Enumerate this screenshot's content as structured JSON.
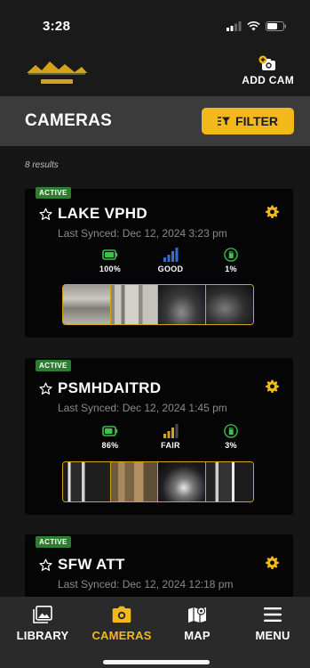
{
  "status_bar": {
    "time": "3:28"
  },
  "header": {
    "add_cam_label": "ADD CAM"
  },
  "title_bar": {
    "title": "CAMERAS",
    "filter_label": "FILTER"
  },
  "results": {
    "count_text": "8 results"
  },
  "cameras": [
    {
      "status": "ACTIVE",
      "name": "LAKE VPHD",
      "last_synced": "Last Synced: Dec 12, 2024 3:23 pm",
      "battery": "100%",
      "signal": "GOOD",
      "storage": "1%"
    },
    {
      "status": "ACTIVE",
      "name": "PSMHDAITRD",
      "last_synced": "Last Synced: Dec 12, 2024 1:45 pm",
      "battery": "86%",
      "signal": "FAIR",
      "storage": "3%"
    },
    {
      "status": "ACTIVE",
      "name": "SFW ATT",
      "last_synced": "Last Synced: Dec 12, 2024 12:18 pm"
    }
  ],
  "bottom_nav": {
    "library": "LIBRARY",
    "cameras": "CAMERAS",
    "map": "MAP",
    "menu": "MENU"
  },
  "colors": {
    "accent": "#f3b91b",
    "active_badge": "#2e7d32",
    "battery": "#3ec24a",
    "signal_good": "#2f6fd6",
    "signal_fair": "#d6a21a"
  }
}
